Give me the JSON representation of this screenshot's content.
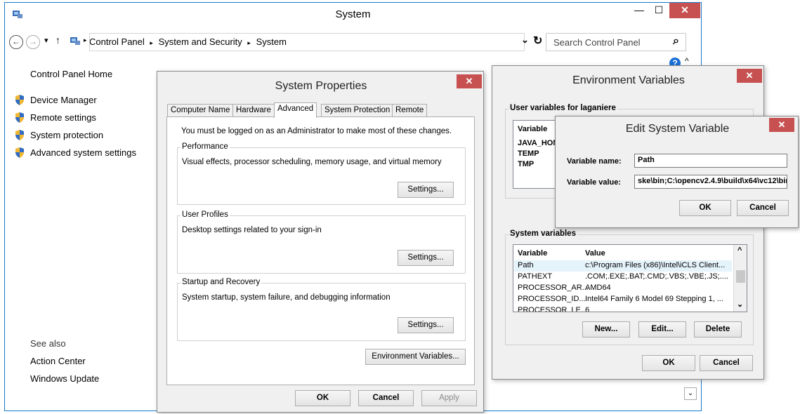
{
  "window": {
    "title": "System",
    "min_glyph": "—",
    "max_glyph": "☐",
    "close_glyph": "✕"
  },
  "nav": {
    "back_glyph": "←",
    "forward_glyph": "→",
    "recent_glyph": "▾",
    "up_glyph": "↑",
    "breadcrumb": [
      "Control Panel",
      "System and Security",
      "System"
    ],
    "breadcrumb_sep": "▸",
    "dropdown_glyph": "⌄",
    "refresh_glyph": "↻",
    "search_placeholder": "Search Control Panel",
    "search_glyph": "⌕"
  },
  "left_pane": {
    "home_link": "Control Panel Home",
    "links": [
      "Device Manager",
      "Remote settings",
      "System protection",
      "Advanced system settings"
    ],
    "see_also_label": "See also",
    "see_also_links": [
      "Action Center",
      "Windows Update"
    ]
  },
  "help_glyph": "?",
  "caret_up": "^",
  "caret_down": "⌄",
  "system_properties": {
    "title": "System Properties",
    "close_glyph": "✕",
    "tabs": [
      "Computer Name",
      "Hardware",
      "Advanced",
      "System Protection",
      "Remote"
    ],
    "active_tab": "Advanced",
    "admin_note": "You must be logged on as an Administrator to make most of these changes.",
    "performance": {
      "title": "Performance",
      "desc": "Visual effects, processor scheduling, memory usage, and virtual memory",
      "button": "Settings..."
    },
    "user_profiles": {
      "title": "User Profiles",
      "desc": "Desktop settings related to your sign-in",
      "button": "Settings..."
    },
    "startup": {
      "title": "Startup and Recovery",
      "desc": "System startup, system failure, and debugging information",
      "button": "Settings..."
    },
    "env_button": "Environment Variables...",
    "ok": "OK",
    "cancel": "Cancel",
    "apply": "Apply"
  },
  "env_vars": {
    "title": "Environment Variables",
    "close_glyph": "✕",
    "user_section_title": "User variables for laganiere",
    "user_columns": [
      "Variable"
    ],
    "user_rows": [
      "JAVA_HOM",
      "TEMP",
      "TMP"
    ],
    "system_section_title": "System variables",
    "system_columns": [
      "Variable",
      "Value"
    ],
    "system_rows": [
      {
        "variable": "Path",
        "value": "c:\\Program Files (x86)\\Intel\\iCLS Client..."
      },
      {
        "variable": "PATHEXT",
        "value": ".COM;.EXE;.BAT;.CMD;.VBS;.VBE;.JS;...."
      },
      {
        "variable": "PROCESSOR_AR...",
        "value": "AMD64"
      },
      {
        "variable": "PROCESSOR_ID...",
        "value": "Intel64 Family 6 Model 69 Stepping 1, ..."
      },
      {
        "variable": "PROCESSOR_LE...",
        "value": "6"
      }
    ],
    "scroll_up": "^",
    "scroll_down": "⌄",
    "new_button": "New...",
    "edit_button": "Edit...",
    "delete_button": "Delete",
    "ok": "OK",
    "cancel": "Cancel"
  },
  "edit_var": {
    "title": "Edit System Variable",
    "close_glyph": "✕",
    "name_label": "Variable name:",
    "name_value": "Path",
    "value_label": "Variable value:",
    "value_value": "ske\\bin;C:\\opencv2.4.9\\build\\x64\\vc12\\bin",
    "ok": "OK",
    "cancel": "Cancel"
  },
  "colors": {
    "window_border": "#1979ca",
    "close_red": "#c75050",
    "dialog_bg": "#f0f0f0",
    "selection": "#e5f3fb",
    "help_blue": "#1a6fd6"
  }
}
